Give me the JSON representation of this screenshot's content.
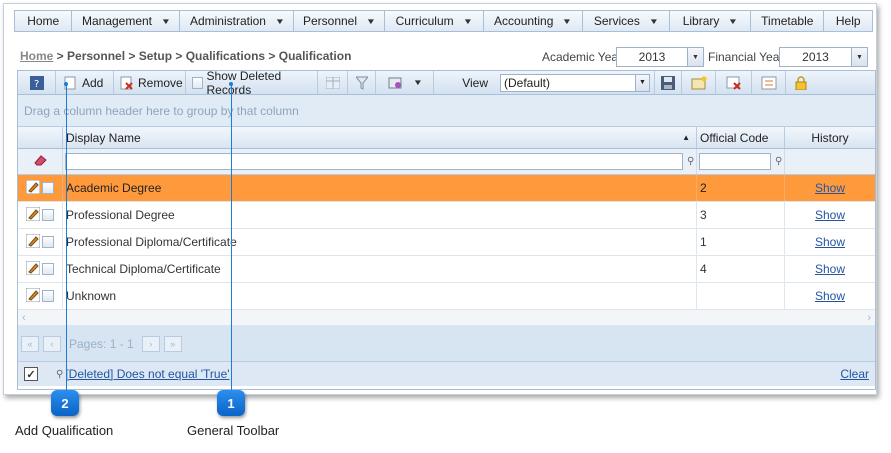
{
  "menu": [
    "Home",
    "Management",
    "Administration",
    "Personnel",
    "Curriculum",
    "Accounting",
    "Services",
    "Library",
    "Timetable",
    "Help"
  ],
  "breadcrumb": {
    "home": "Home",
    "rest": " > Personnel > Setup > Qualifications > Qualification"
  },
  "academic_year": {
    "label": "Academic Year",
    "value": "2013"
  },
  "financial_year": {
    "label": "Financial Year",
    "value": "2013"
  },
  "toolbar": {
    "add": "Add",
    "remove": "Remove",
    "show_deleted": "Show Deleted Records",
    "view_label": "View",
    "view_value": "(Default)"
  },
  "group_hint": "Drag a column header here to group by that column",
  "columns": {
    "display_name": "Display Name",
    "official_code": "Official Code",
    "history": "History"
  },
  "rows": [
    {
      "name": "Academic Degree",
      "code": "2",
      "history": "Show"
    },
    {
      "name": "Professional Degree",
      "code": "3",
      "history": "Show"
    },
    {
      "name": "Professional Diploma/Certificate",
      "code": "1",
      "history": "Show"
    },
    {
      "name": "Technical Diploma/Certificate",
      "code": "4",
      "history": "Show"
    },
    {
      "name": "Unknown",
      "code": "",
      "history": "Show"
    }
  ],
  "pager": {
    "text": "Pages: 1 - 1"
  },
  "footer": {
    "filter": "[Deleted] Does not equal 'True'",
    "clear": "Clear"
  },
  "callouts": [
    {
      "number": "2",
      "label": "Add Qualification"
    },
    {
      "number": "1",
      "label": "General Toolbar"
    }
  ]
}
